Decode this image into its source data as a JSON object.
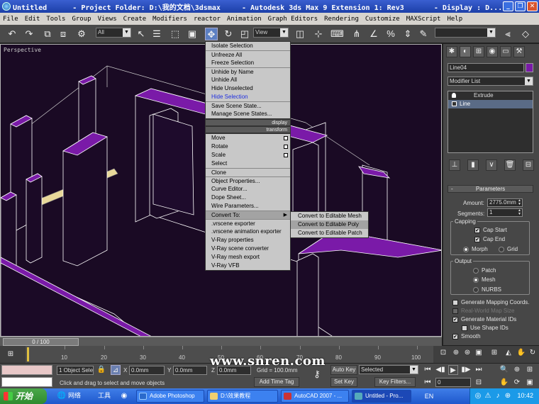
{
  "window": {
    "title": "Untitled      - Project Folder: D:\\我的文档\\3dsmax     - Autodesk 3ds Max 9 Extension 1: Rev3       - Display : D...",
    "controls": [
      "_",
      "❐",
      "✕"
    ]
  },
  "menubar": [
    "File",
    "Edit",
    "Tools",
    "Group",
    "Views",
    "Create",
    "Modifiers",
    "reactor",
    "Animation",
    "Graph Editors",
    "Rendering",
    "Customize",
    "MAXScript",
    "Help"
  ],
  "toolbar": {
    "selection_filter": "All",
    "reference_coord": "View"
  },
  "viewport": {
    "label": "Perspective"
  },
  "quad_menu": {
    "display_items": [
      "Isolate Selection",
      "Unfreeze All",
      "Freeze Selection",
      "Unhide by Name",
      "Unhide All",
      "Hide Unselected",
      "Hide Selection",
      "Save Scene State...",
      "Manage Scene States..."
    ],
    "display_header": "display",
    "transform_header": "transform",
    "transform_items": [
      "Move",
      "Rotate",
      "Scale",
      "Select",
      "Clone",
      "Object Properties...",
      "Curve Editor...",
      "Dope Sheet...",
      "Wire Parameters...",
      "Convert To:",
      ".vrscene exporter",
      ".vrscene animation exporter",
      "V-Ray properties",
      "V-Ray scene converter",
      "V-Ray mesh export",
      "V-Ray VFB"
    ],
    "submenu": [
      "Convert to Editable Mesh",
      "Convert to Editable Poly",
      "Convert to Editable Patch"
    ]
  },
  "command_panel": {
    "object_name": "Line04",
    "object_color": "#7a1aa8",
    "modifier_list": "Modifier List",
    "stack": [
      "Extrude",
      "Line"
    ],
    "parameters_title": "Parameters",
    "amount_label": "Amount:",
    "amount_value": "2775.0mm",
    "segments_label": "Segments:",
    "segments_value": "1",
    "capping_label": "Capping",
    "cap_start": "Cap Start",
    "cap_end": "Cap End",
    "morph": "Morph",
    "grid": "Grid",
    "output_label": "Output",
    "patch": "Patch",
    "mesh": "Mesh",
    "nurbs": "NURBS",
    "gen_mapping": "Generate Mapping Coords.",
    "real_world": "Real-World Map Size",
    "gen_material": "Generate Material IDs",
    "use_shape": "Use Shape IDs",
    "smooth": "Smooth"
  },
  "timeline": {
    "frame": "0 / 100",
    "ticks": [
      "10",
      "20",
      "30",
      "40",
      "50",
      "60",
      "70",
      "80",
      "90",
      "100"
    ]
  },
  "status": {
    "selection": "1 Object Sele",
    "x_label": "X",
    "x_value": "0.0mm",
    "y_label": "Y",
    "y_value": "0.0mm",
    "z_label": "Z",
    "z_value": "0.0mm",
    "grid": "Grid = 100.0mm",
    "prompt": "Click and drag to select and move objects",
    "add_time_tag": "Add Time Tag",
    "auto_key": "Auto Key",
    "set_key": "Set Key",
    "key_mode": "Selected",
    "key_filters": "Key Filters...",
    "frame_field": "0"
  },
  "taskbar": {
    "start": "开始",
    "quick1": "网络",
    "quick2": "工具",
    "items": [
      "Adobe Photoshop",
      "D:\\效果教程",
      "AutoCAD 2007 - ...",
      "Untitled   - Pro..."
    ],
    "clock": "10:42"
  },
  "watermark": "www.snren.com"
}
